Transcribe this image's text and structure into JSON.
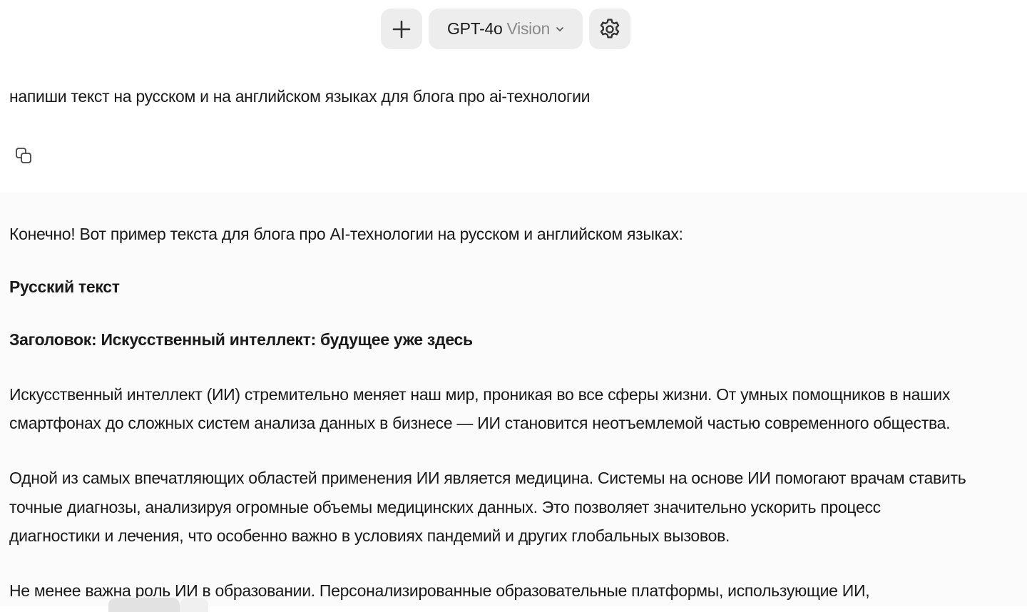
{
  "toolbar": {
    "new_chat_icon": "plus-icon",
    "model_name": "GPT-4o",
    "model_variant": "Vision",
    "dropdown_icon": "chevron-down-icon",
    "settings_icon": "gear-icon"
  },
  "user_message": {
    "text": "напиши текст на русском и на английском языках для блога про ai-технологии",
    "copy_icon": "copy-icon"
  },
  "assistant_message": {
    "intro": "Конечно! Вот пример текста для блога про AI-технологии на русском и английском языках:",
    "section_heading": "Русский текст",
    "title": "Заголовок: Искусственный интеллект: будущее уже здесь",
    "p1_line1": "Искусственный интеллект (ИИ) стремительно меняет наш мир, проникая во все сферы жизни. От умных помощников в наших",
    "p1_line2": "смартфонах до сложных систем анализа данных в бизнесе — ИИ становится неотъемлемой частью современного общества.",
    "p2_line1": "Одной из самых впечатляющих областей применения ИИ является медицина. Системы на основе ИИ помогают врачам ставить",
    "p2_line2": "точные диагнозы, анализируя огромные объемы медицинских данных. Это позволяет значительно ускорить процесс",
    "p2_line3": "диагностики и лечения, что особенно важно в условиях пандемий и других глобальных вызовов.",
    "p3_line1": "Не менее важна роль ИИ в образовании. Персонализированные образовательные платформы, использующие ИИ,"
  }
}
